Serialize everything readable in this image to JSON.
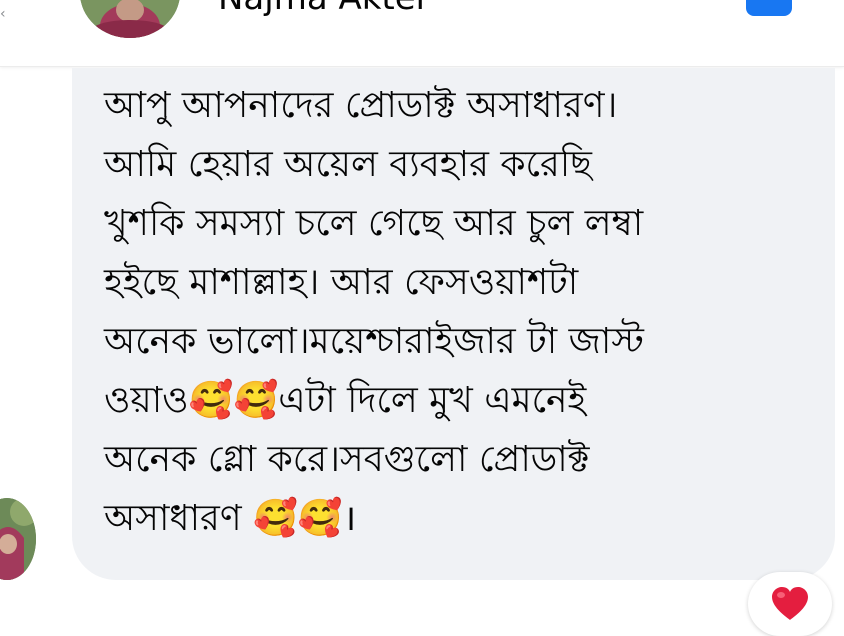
{
  "header": {
    "contact_name": "Najma Akter"
  },
  "message": {
    "text": "আপু আপনাদের প্রোডাক্ট অসাধারণ।\nআমি হেয়ার অয়েল ব্যবহার করেছি\nখুশকি সমস্যা চলে গেছে আর চুল লম্বা\nহইছে মাশাল্লাহ। আর ফেসওয়াশটা\nঅনেক ভালো।ময়েশ্চারাইজার টা জাস্ট\nওয়াও🥰🥰এটা দিলে মুখ এমনেই\nঅনেক গ্লো করে।সবগুলো প্রোডাক্ট\nঅসাধারণ 🥰🥰।"
  },
  "reaction": {
    "icon": "heart-icon",
    "color": "#e41e3f"
  },
  "colors": {
    "bubble_background": "#f0f2f5",
    "accent": "#1877f2",
    "text": "#050505"
  }
}
